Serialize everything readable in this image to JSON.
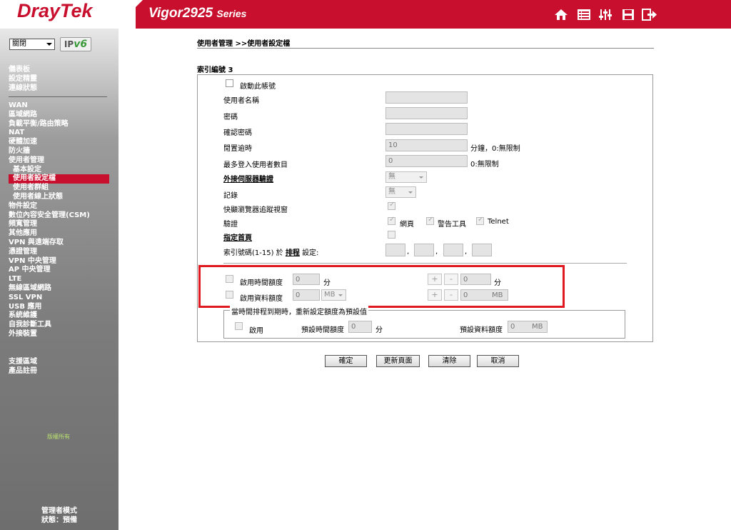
{
  "header": {
    "brand": "DrayTek",
    "product": "Vigor2925",
    "series": "Series",
    "icons": [
      "home-icon",
      "list-icon",
      "sliders-icon",
      "save-icon",
      "logout-icon"
    ]
  },
  "sidebar": {
    "language": "關閉",
    "ipv6_label": "IP",
    "ipv6_version": "v6",
    "group1": [
      "儀表板",
      "設定精靈",
      "連線狀態"
    ],
    "items": [
      "WAN",
      "區域網路",
      "負載平衡/路由策略",
      "NAT",
      "硬體加速",
      "防火牆",
      "使用者管理"
    ],
    "sub_items": [
      "基本設定",
      "使用者設定檔",
      "使用者群組",
      "使用者線上狀態"
    ],
    "items2": [
      "物件設定",
      "數位內容安全管理(CSM)",
      "頻寬管理",
      "其他應用",
      "VPN 與遠端存取",
      "憑證管理",
      "VPN 中央管理",
      "AP 中央管理",
      "LTE",
      "無線區域網路",
      "SSL VPN",
      "USB 應用",
      "系統維護",
      "自我診斷工具",
      "外接裝置"
    ],
    "support": [
      "支援區域",
      "產品註冊"
    ],
    "copyright": "版權所有",
    "mode": "管理者模式",
    "status": "狀態：預備"
  },
  "main": {
    "breadcrumb": "使用者管理 >>使用者設定檔",
    "index_label": "索引編號 3",
    "enable_account": "啟動此帳號",
    "username_label": "使用者名稱",
    "password_label": "密碼",
    "confirm_password_label": "確認密碼",
    "idle_timeout_label": "閒置逾時",
    "idle_timeout_value": "10",
    "idle_timeout_unit": "分鐘，0:無限制",
    "max_login_label": "最多登入使用者數目",
    "max_login_value": "0",
    "max_login_unit": "0:無限制",
    "ext_server_label": "外接伺服器驗證",
    "ext_server_value": "無",
    "log_label": "記錄",
    "log_value": "無",
    "popup_label": "快顯瀏覽器追蹤視窗",
    "auth_label": "驗證",
    "auth_web": "網頁",
    "auth_alert": "警告工具",
    "auth_telnet": "Telnet",
    "landing_label": "指定首頁",
    "schedule_prefix": "索引號碼(1-15) 於",
    "schedule_link": "排程",
    "schedule_suffix": "設定:",
    "time_quota_label": "啟用時間額度",
    "time_quota_value": "0",
    "time_quota_unit": "分",
    "data_quota_label": "啟用資料額度",
    "data_quota_value": "0",
    "data_quota_unit_select": "MB",
    "time_adjust_value": "0",
    "time_adjust_unit": "分",
    "data_adjust_value": "0",
    "data_adjust_unit": "MB",
    "reset_legend": "當時間排程到期時，重新設定額度為預設值",
    "reset_enable": "啟用",
    "default_time_label": "預設時間額度",
    "default_time_value": "0",
    "default_time_unit": "分",
    "default_data_label": "預設資料額度",
    "default_data_value": "0",
    "default_data_unit": "MB",
    "plus": "+",
    "minus": "-",
    "comma": ","
  },
  "buttons": {
    "ok": "確定",
    "refresh": "更新頁面",
    "clear": "清除",
    "cancel": "取消"
  }
}
